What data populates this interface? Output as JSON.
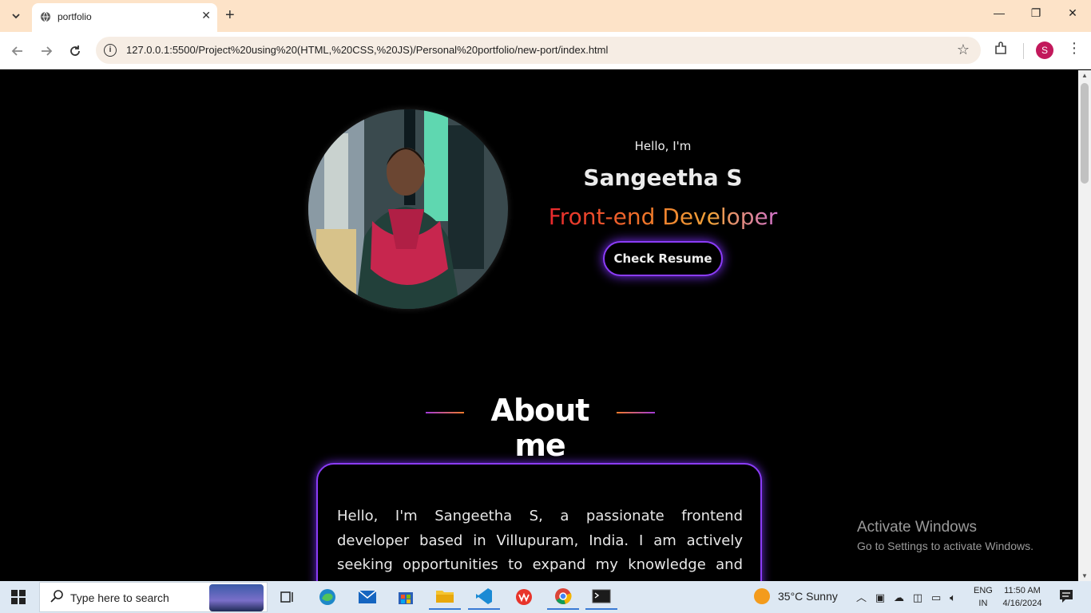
{
  "browser": {
    "tab_title": "portfolio",
    "url": "127.0.0.1:5500/Project%20using%20(HTML,%20CSS,%20JS)/Personal%20portfolio/new-port/index.html",
    "profile_initial": "S"
  },
  "hero": {
    "greeting": "Hello, I'm",
    "name": "Sangeetha S",
    "role": "Front-end Developer",
    "resume_button": "Check Resume"
  },
  "about": {
    "title": "About me",
    "paragraph": "Hello, I'm Sangeetha S, a passionate frontend developer based in Villupuram, India. I am actively seeking opportunities to expand my knowledge and contribute to"
  },
  "watermark": {
    "title": "Activate Windows",
    "subtitle": "Go to Settings to activate Windows."
  },
  "taskbar": {
    "search_placeholder": "Type here to search",
    "weather": "35°C  Sunny",
    "lang_line1": "ENG",
    "lang_line2": "IN",
    "time": "11:50 AM",
    "date": "4/16/2024"
  },
  "colors": {
    "accent_purple": "#8b3cf7",
    "role_gradient_start": "#e8232d",
    "role_gradient_end": "#d06fd8"
  }
}
